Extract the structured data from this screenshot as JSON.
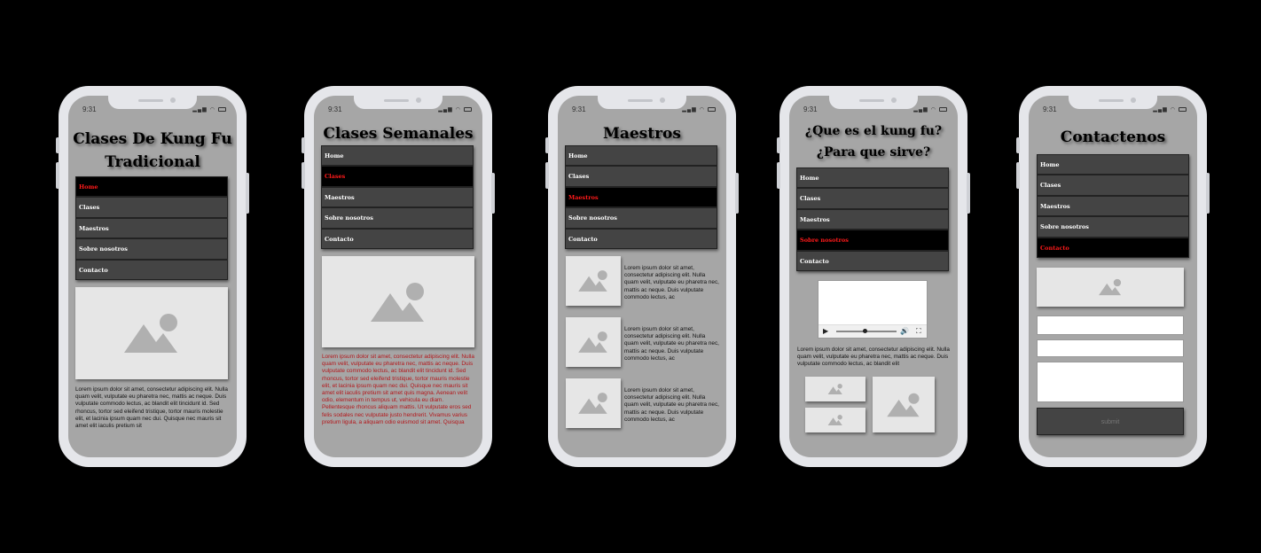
{
  "status_time": "9:31",
  "nav_items": [
    "Home",
    "Clases",
    "Maestros",
    "Sobre nosotros",
    "Contacto"
  ],
  "lorem_short": "Lorem ipsum dolor sit amet, consectetur adipiscing elit. Nulla quam velit, vulputate eu pharetra nec, mattis ac neque. Duis vulputate commodo lectus, ac",
  "screens": [
    {
      "title_line1": "Clases De Kung Fu",
      "title_line2": "Tradicional",
      "active": "Home",
      "paragraph": "Lorem ipsum dolor sit amet, consectetur adipiscing elit. Nulla quam velit, vulputate eu pharetra nec, mattis ac neque. Duis vulputate commodo lectus, ac blandit elit tincidunt id. Sed rhoncus, tortor sed eleifend tristique, tortor mauris molestie elit, et lacinia ipsum quam nec dui. Quisque nec mauris sit amet elit iaculis pretium sit"
    },
    {
      "title_line1": "Clases Semanales",
      "active": "Clases",
      "paragraph": "Lorem ipsum dolor sit amet, consectetur adipiscing elit. Nulla quam velit, vulputate eu pharetra nec, mattis ac neque. Duis vulputate commodo lectus, ac blandit elit tincidunt id. Sed rhoncus, tortor sed eleifend tristique, tortor mauris molestie elit, et lacinia ipsum quam nec dui. Quisque nec mauris sit amet elit iaculis pretium sit amet quis magna. Aenean velit odio, elementum in tempus ut, vehicula eu diam. Pellentesque rhoncus aliquam mattis. Ut vulputate eros sed felis sodales nec vulputate justo hendrerit. Vivamus varius pretium ligula, a aliquam odio euismod sit amet. Quisqua"
    },
    {
      "title_line1": "Maestros",
      "active": "Maestros"
    },
    {
      "title_line1": "¿Que es el kung fu?",
      "title_line2": "¿Para que sirve?",
      "active": "Sobre nosotros",
      "paragraph": "Lorem ipsum dolor sit amet, consectetur adipiscing elit. Nulla quam velit, vulputate eu pharetra nec, mattis ac neque. Duis vulputate commodo lectus, ac blandit elit"
    },
    {
      "title_line1": "Contactenos",
      "active": "Contacto",
      "submit_label": "submit"
    }
  ]
}
